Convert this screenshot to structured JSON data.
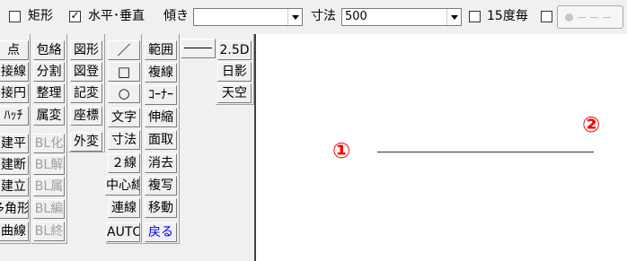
{
  "toolbar": {
    "rect_checkbox": {
      "label": "矩形",
      "checked": false
    },
    "ortho_checkbox": {
      "label": "水平･垂直",
      "checked": true,
      "check_glyph": "✓"
    },
    "angle_label": "傾き",
    "angle_value": "",
    "dimension_label": "寸法",
    "dimension_value": "500",
    "deg15_checkbox": {
      "label": "15度毎",
      "checked": false
    },
    "extra_checkbox": {
      "checked": false
    },
    "line_style_icon": "line-style-dot-dash-icon"
  },
  "palette": {
    "col1": [
      "点",
      "接線",
      "接円",
      "ﾊｯﾁ",
      "建平",
      "建断",
      "建立",
      "多角形",
      "曲線"
    ],
    "col2": [
      "包絡",
      "分割",
      "整理",
      "属変",
      "BL化",
      "BL解",
      "BL属",
      "BL編",
      "BL終"
    ],
    "col3": [
      "図形",
      "図登",
      "記変",
      "座標",
      "外変"
    ],
    "col4": [
      "／",
      "□",
      "○",
      "文字",
      "寸法",
      "２線",
      "中心線",
      "連線",
      "AUTO"
    ],
    "col5": [
      "範囲",
      "複線",
      "ｺｰﾅｰ",
      "伸縮",
      "面取",
      "消去",
      "複写",
      "移動",
      "戻る"
    ],
    "col6": [
      "2.5D",
      "日影",
      "天空"
    ],
    "line_type_button": "line-type-icon",
    "colors": {
      "disabled": "#a0a0a0",
      "undo": "#0000ee"
    }
  },
  "canvas": {
    "marker1": "①",
    "marker2": "②",
    "marker_color": "#ff0000"
  }
}
